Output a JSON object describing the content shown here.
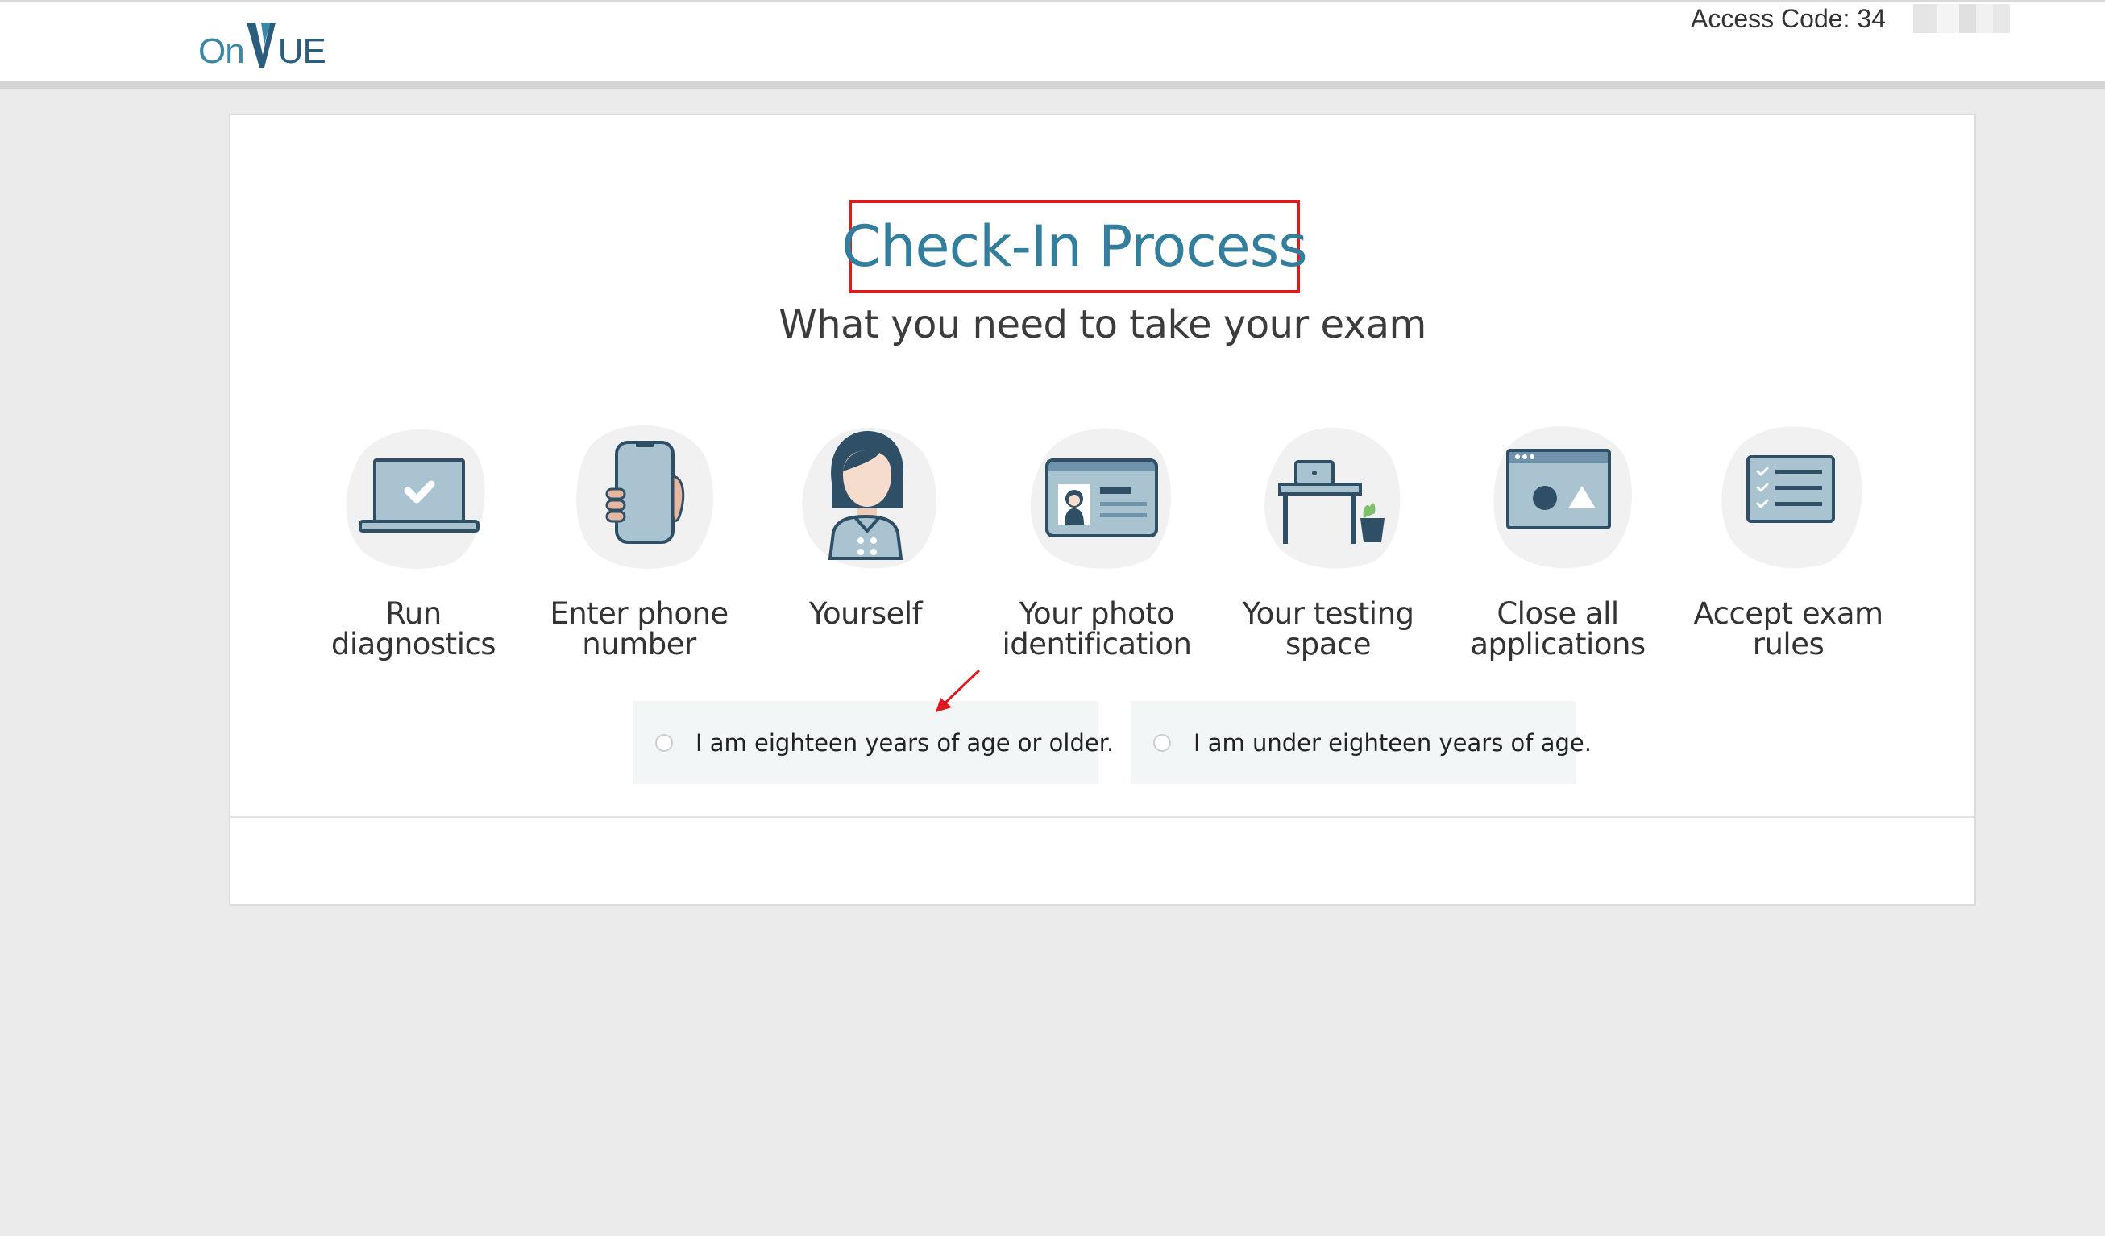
{
  "header": {
    "logo": {
      "on": "On",
      "v": "V",
      "ue": "UE"
    },
    "access_code": {
      "label": "Access Code: 34"
    }
  },
  "main": {
    "title": "Check-In Process",
    "subtitle": "What you need to take your exam",
    "steps": [
      {
        "label": "Run diagnostics",
        "icon": "laptop-check-icon"
      },
      {
        "label": "Enter phone number",
        "icon": "phone-in-hand-icon"
      },
      {
        "label": "Yourself",
        "icon": "person-icon"
      },
      {
        "label": "Your photo identification",
        "icon": "id-card-icon"
      },
      {
        "label": "Your testing space",
        "icon": "desk-icon"
      },
      {
        "label": "Close all applications",
        "icon": "app-window-icon"
      },
      {
        "label": "Accept exam rules",
        "icon": "checklist-icon"
      }
    ],
    "age_options": [
      {
        "label": "I am eighteen years of age or older.",
        "selected": false
      },
      {
        "label": "I am under eighteen years of age.",
        "selected": false
      }
    ]
  },
  "colors": {
    "accent": "#327e9c",
    "highlight_box": "#e0191e",
    "icon_fill": "#a9c3d1",
    "icon_stroke": "#2e4f66",
    "icon_blob": "#f1f1f1",
    "page_bg": "#ebebeb"
  }
}
